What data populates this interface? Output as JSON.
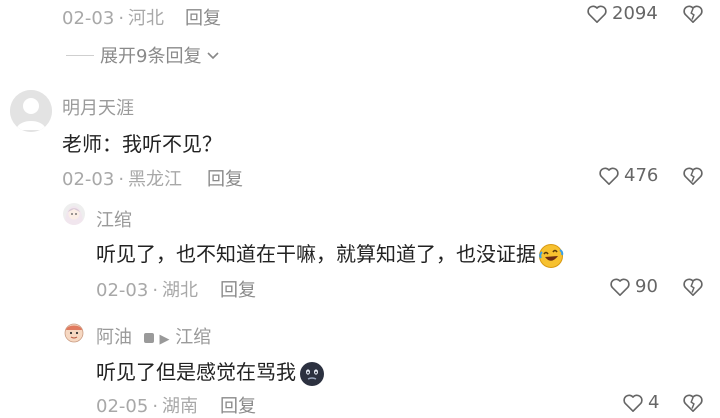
{
  "top_comment": {
    "date": "02-03",
    "location": "河北",
    "reply_label": "回复",
    "likes": "2094"
  },
  "expand": {
    "label": "展开9条回复"
  },
  "comment1": {
    "username": "明月天涯",
    "text": "老师：我听不见？",
    "date": "02-03",
    "location": "黑龙江",
    "reply_label": "回复",
    "likes": "476"
  },
  "reply1": {
    "username": "江绾",
    "text": "听见了，也不知道在干嘛，就算知道了，也没证据",
    "emoji": "rofl-emoji",
    "date": "02-03",
    "location": "湖北",
    "reply_label": "回复",
    "likes": "90"
  },
  "reply2": {
    "username": "阿油",
    "reply_to": "江绾",
    "text": "听见了但是感觉在骂我",
    "emoji": "dark-face-emoji",
    "date": "02-05",
    "location": "湖南",
    "reply_label": "回复",
    "likes": "4"
  },
  "icons": {
    "like": "heart-icon",
    "dislike": "broken-heart-icon",
    "expand": "chevron-down-icon"
  },
  "colors": {
    "meta": "#a8a8a8",
    "text": "#222222",
    "background": "#ffffff"
  }
}
